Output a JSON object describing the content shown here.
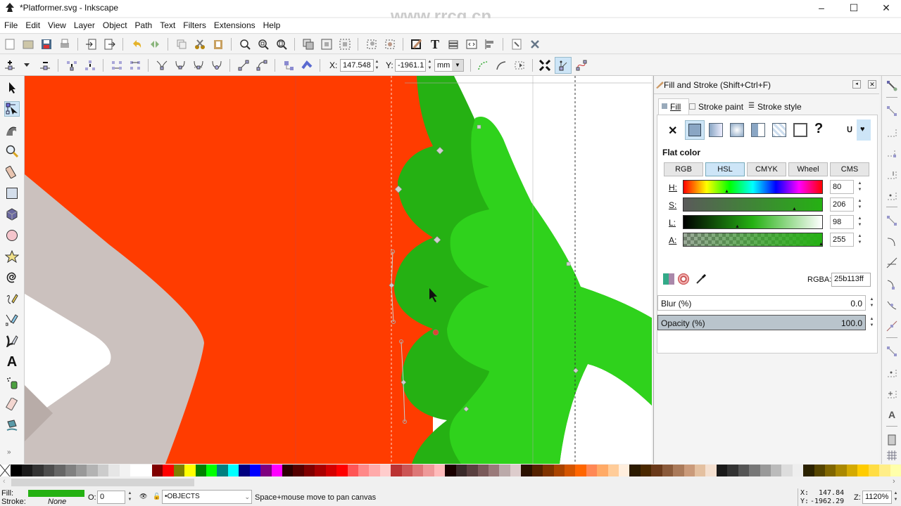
{
  "window": {
    "title": "*Platformer.svg - Inkscape",
    "minimize": "–",
    "maximize": "☐",
    "close": "✕"
  },
  "menu": [
    "File",
    "Edit",
    "View",
    "Layer",
    "Object",
    "Path",
    "Text",
    "Filters",
    "Extensions",
    "Help"
  ],
  "watermark": "www.rrcg.cn",
  "commands": [
    "new-document",
    "open",
    "save",
    "print",
    "import",
    "export",
    "undo",
    "redo",
    "duplicate",
    "cut",
    "paste",
    "zoom-selection",
    "zoom-drawing",
    "zoom-page",
    "clone",
    "group",
    "ungroup",
    "object-to-path",
    "stroke-to-path",
    "fill-and-stroke",
    "text-and-font",
    "layers",
    "xml-editor",
    "align-distribute",
    "document-properties",
    "preferences"
  ],
  "node_controls": {
    "x_label": "X:",
    "x_value": "147.548",
    "y_label": "Y:",
    "y_value": "-1961.1",
    "unit": "mm"
  },
  "tools": [
    "select",
    "node",
    "tweak",
    "zoom",
    "measure",
    "rectangle",
    "3d-box",
    "ellipse",
    "star",
    "spiral",
    "pencil",
    "pen",
    "calligraphy",
    "text",
    "spray",
    "eraser",
    "paint-bucket"
  ],
  "toolbox_more": "»",
  "panel": {
    "title": "Fill and Stroke (Shift+Ctrl+F)",
    "tabs": [
      "Fill",
      "Stroke paint",
      "Stroke style"
    ],
    "paint_type_label": "Flat color",
    "unknown_glyph": "?",
    "none_glyph": "✕",
    "modes": [
      "RGB",
      "HSL",
      "CMYK",
      "Wheel",
      "CMS"
    ],
    "active_mode": "HSL",
    "sliders": [
      {
        "label": "H:",
        "value": "80"
      },
      {
        "label": "S:",
        "value": "206"
      },
      {
        "label": "L:",
        "value": "98"
      },
      {
        "label": "A:",
        "value": "255"
      }
    ],
    "rgba_label": "RGBA:",
    "rgba_value": "25b113ff",
    "blur_label": "Blur (%)",
    "blur_value": "0.0",
    "opacity_label": "Opacity (%)",
    "opacity_value": "100.0"
  },
  "colors": {
    "fill_green": "#25b113",
    "light_green": "#2fd21c",
    "canvas_red": "#ff3c00",
    "gray_shape": "#cbc1be"
  },
  "status": {
    "fill_label": "Fill:",
    "stroke_label": "Stroke:",
    "stroke_value": "None",
    "opacity_label": "O:",
    "opacity_value": "0",
    "layer": "•OBJECTS",
    "message": "Space+mouse move to pan canvas",
    "cursor_x_label": "X:",
    "cursor_x": "147.84",
    "cursor_y_label": "Y:",
    "cursor_y": "-1962.29",
    "zoom_label": "Z:",
    "zoom": "1120%"
  }
}
